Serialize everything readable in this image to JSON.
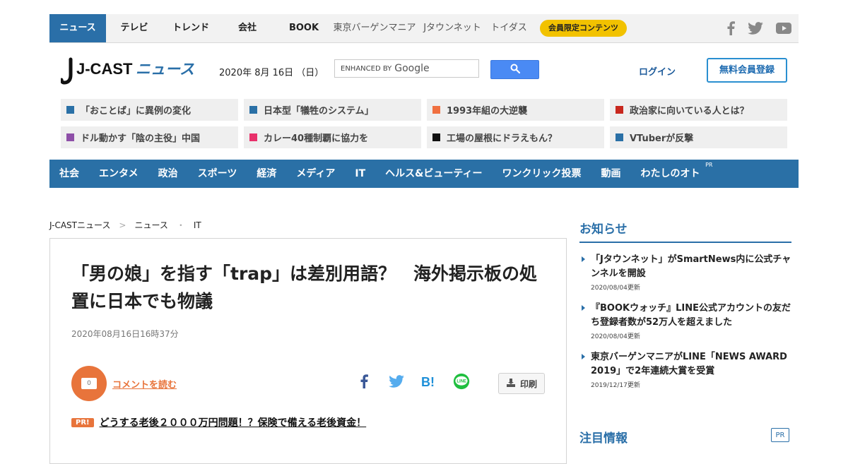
{
  "topnav": {
    "items": [
      "ニュース",
      "テレビ",
      "トレンド",
      "会社",
      "BOOK",
      "東京バーゲンマニア",
      "Jタウンネット",
      "トイダス"
    ],
    "member_badge": "会員限定コンテンツ",
    "social": [
      "facebook-icon",
      "twitter-icon",
      "youtube-icon"
    ]
  },
  "header": {
    "logo_text_brand": "J-CAST",
    "logo_text_section": "ニュース",
    "date": "2020年 8月 16日 （日）",
    "search_brand_small": "ENHANCED BY",
    "search_brand": "Google",
    "login": "ログイン",
    "register": "無料会員登録"
  },
  "trending": [
    {
      "label": "「おことば」に異例の変化",
      "color": "#2a70a6"
    },
    {
      "label": "日本型「犠牲のシステム」",
      "color": "#2a70a6"
    },
    {
      "label": "1993年組の大逆襲",
      "color": "#f07040"
    },
    {
      "label": "政治家に向いている人とは？",
      "color": "#c8281e"
    },
    {
      "label": "ドル動かす「陰の主役」中国",
      "color": "#8e4fa8"
    },
    {
      "label": "カレー40種制覇に協力を",
      "color": "#e8306a"
    },
    {
      "label": "工場の屋根にドラえもん？",
      "color": "#111111"
    },
    {
      "label": "VTuberが反撃",
      "color": "#2a70a6"
    }
  ],
  "categories": [
    "社会",
    "エンタメ",
    "政治",
    "スポーツ",
    "経済",
    "メディア",
    "IT",
    "ヘルス&ビューティー",
    "ワンクリック投票",
    "動画",
    "わたしのオト"
  ],
  "category_pr": "PR",
  "breadcrumb": [
    "J-CASTニュース",
    "ニュース",
    "IT"
  ],
  "article": {
    "headline": "「男の娘」を指す「trap」は差別用語？　海外掲示板の処置に日本でも物議",
    "published": "2020年08月16日16時37分",
    "comment_count": "0",
    "comment_link": "コメントを読む",
    "print": "印刷",
    "pr_badge": "PR!",
    "pr_link": "どうする老後２０００万円問題！？保険で備える老後資金！"
  },
  "sidebar": {
    "notice_title": "お知らせ",
    "notices": [
      {
        "headline": "「Jタウンネット」がSmartNews内に公式チャンネルを開設",
        "date": "2020/08/04更新"
      },
      {
        "headline": "『BOOKウォッチ』LINE公式アカウントの友だち登録者数が52万人を超えました",
        "date": "2020/08/04更新"
      },
      {
        "headline": "東京バーゲンマニアがLINE「NEWS AWARD 2019」で2年連続大賞を受賞",
        "date": "2019/12/17更新"
      }
    ],
    "attention_title": "注目情報",
    "attention_pr": "PR"
  }
}
